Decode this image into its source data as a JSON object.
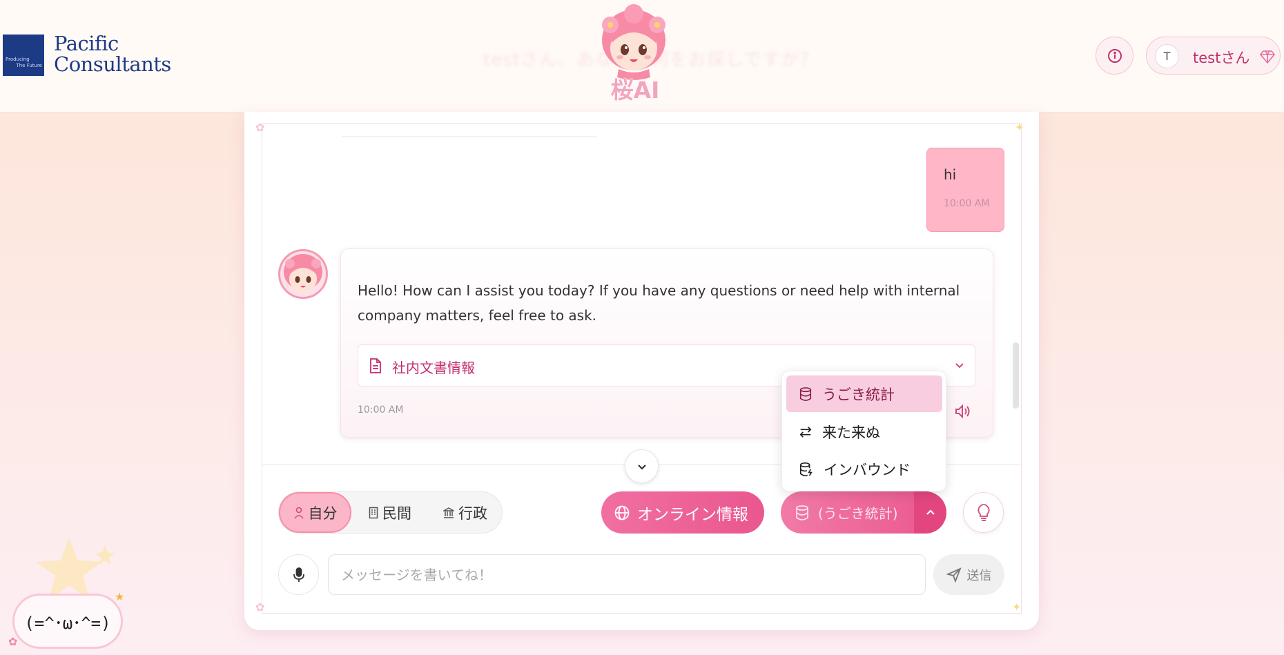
{
  "header": {
    "logo_small_line1": "Producing",
    "logo_small_line2": "The Future",
    "logo_line1": "Pacific",
    "logo_line2": "Consultants",
    "ghost_greeting": "testさん、あなたは何をお探しですか？",
    "mascot_title": "桜AI",
    "user_initial": "T",
    "user_name": "testさん"
  },
  "chat": {
    "messages": [
      {
        "role": "user",
        "text": "hi",
        "time": "10:00 AM"
      },
      {
        "role": "assistant",
        "text": "Hello! How can I assist you today? If you have any questions or need help with internal company matters, feel free to ask.",
        "source_label": "社内文書情報",
        "time": "10:00 AM"
      }
    ]
  },
  "controls": {
    "scope": {
      "items": [
        {
          "label": "自分",
          "icon": "person-icon",
          "active": true
        },
        {
          "label": "民間",
          "icon": "building-icon",
          "active": false
        },
        {
          "label": "行政",
          "icon": "government-icon",
          "active": false
        }
      ]
    },
    "online_label": "オンライン情報",
    "stats_label": "(うごき統計)",
    "dropdown": [
      {
        "label": "うごき統計",
        "icon": "database-icon",
        "selected": true
      },
      {
        "label": "来た来ぬ",
        "icon": "arrows-swap-icon",
        "selected": false
      },
      {
        "label": "インバウンド",
        "icon": "database-bolt-icon",
        "selected": false
      }
    ]
  },
  "composer": {
    "placeholder": "メッセージを書いてね！",
    "send_label": "送信"
  },
  "kaomoji": "(=^･ω･^=)",
  "colors": {
    "accent": "#e9578f",
    "accent_light": "#fbb6c7",
    "brand_blue": "#1d3a85"
  }
}
